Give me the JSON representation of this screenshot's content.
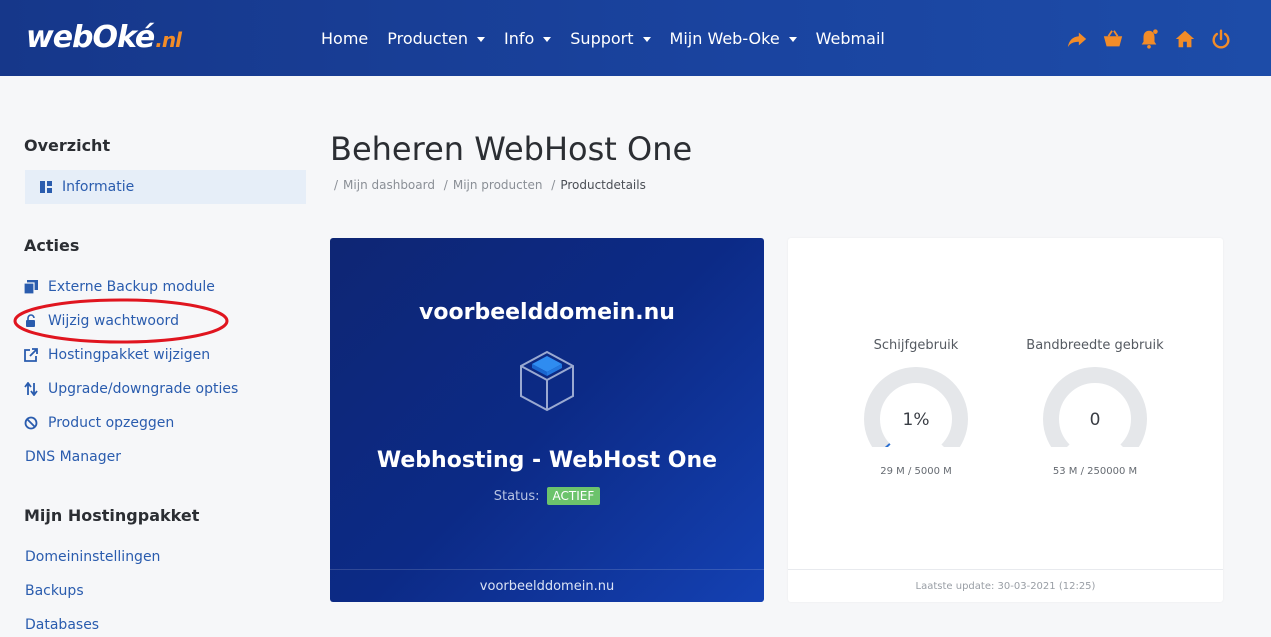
{
  "header": {
    "logo_main": "webOké",
    "logo_tld": ".nl",
    "nav": [
      {
        "label": "Home",
        "dropdown": false
      },
      {
        "label": "Producten",
        "dropdown": true
      },
      {
        "label": "Info",
        "dropdown": true
      },
      {
        "label": "Support",
        "dropdown": true
      },
      {
        "label": "Mijn Web-Oke",
        "dropdown": true
      },
      {
        "label": "Webmail",
        "dropdown": false
      }
    ],
    "icons": [
      "share-icon",
      "basket-icon",
      "bell-icon",
      "home-icon",
      "power-icon"
    ],
    "icon_color": "#f28c28"
  },
  "sidebar": {
    "overview_heading": "Overzicht",
    "overview_active": "Informatie",
    "actions_heading": "Acties",
    "actions": [
      "Externe Backup module",
      "Wijzig wachtwoord",
      "Hostingpakket wijzigen",
      "Upgrade/downgrade opties",
      "Product opzeggen",
      "DNS Manager"
    ],
    "package_heading": "Mijn Hostingpakket",
    "package_links": [
      "Domeininstellingen",
      "Backups",
      "Databases"
    ]
  },
  "main": {
    "title": "Beheren WebHost One",
    "breadcrumb": [
      "Mijn dashboard",
      "Mijn producten",
      "Productdetails"
    ],
    "product": {
      "domain": "voorbeelddomein.nu",
      "name": "Webhosting - WebHost One",
      "status_label": "Status:",
      "status_value": "ACTIEF",
      "footer_domain": "voorbeelddomein.nu"
    },
    "stats": {
      "disk": {
        "title": "Schijfgebruik",
        "value": "1%",
        "detail": "29 M / 5000 M",
        "fraction": 0.01
      },
      "bandwidth": {
        "title": "Bandbreedte gebruik",
        "value": "0",
        "detail": "53 M / 250000 M",
        "fraction": 0.0
      },
      "last_update": "Laatste update: 30-03-2021 (12:25)"
    }
  },
  "colors": {
    "header_bg": "#1a44a0",
    "accent": "#f28c28",
    "link": "#2a5cae",
    "badge": "#6cc36c",
    "annotation": "#e0151f"
  }
}
